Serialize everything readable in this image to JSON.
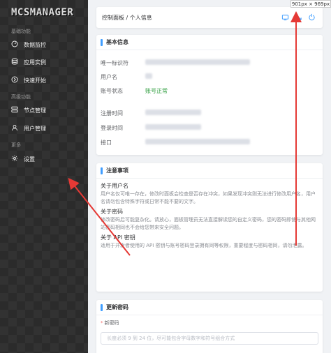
{
  "app": {
    "logo": "MCSMANAGER"
  },
  "sidebar": {
    "groups": [
      {
        "title": "基础功能"
      },
      {
        "title": "高级功能"
      },
      {
        "title": "更多"
      }
    ],
    "items": [
      {
        "label": "数据监控",
        "icon": "dashboard-icon"
      },
      {
        "label": "应用实例",
        "icon": "database-icon"
      },
      {
        "label": "快速开始",
        "icon": "rocket-icon"
      },
      {
        "label": "节点管理",
        "icon": "nodes-icon"
      },
      {
        "label": "用户管理",
        "icon": "user-icon"
      },
      {
        "label": "设置",
        "icon": "gear-icon"
      }
    ]
  },
  "header": {
    "breadcrumb": "控制面板 / 个人信息",
    "icons": [
      "refresh-icon",
      "expand-icon",
      "logout-icon"
    ]
  },
  "basic_info": {
    "title": "基本信息",
    "fields": [
      {
        "label": "唯一标识符",
        "value": ""
      },
      {
        "label": "用户名",
        "value": ""
      },
      {
        "label": "账号状态",
        "value": "账号正常"
      },
      {
        "label": "注册时间",
        "value": ""
      },
      {
        "label": "登录时间",
        "value": ""
      },
      {
        "label": "接口",
        "value": ""
      }
    ]
  },
  "notes": {
    "title": "注意事项",
    "sections": [
      {
        "heading": "关于用户名",
        "text": "用户名仅可唯一存在，修改时面板会检查是否存在冲突，如果发现冲突则无法进行修改用户名，用户名请勿包含特殊字符或日常不能不要的文字。"
      },
      {
        "heading": "关于密码",
        "text": "修改密码后可能复杂化。请放心，面板管理员无法直接解读您的自定义密码，您的密码即使与其他网站密码相同也不会给您带来安全问题。"
      },
      {
        "heading": "关于 API 密钥",
        "text": "适用于开发者使用的 API 密钥与账号密码登录拥有同等权限，重要程度与密码相同，请勿泄露。"
      }
    ]
  },
  "password": {
    "title": "更新密码",
    "field_label": "新密码",
    "placeholder": "长度必须 9 到 24 位，尽可能包含字母数字和符号组合方式"
  },
  "tooltip": {
    "text": "901px × 969px"
  },
  "colors": {
    "accent": "#409eff",
    "annotation": "#e53935",
    "status_ok": "#2c9c3c"
  }
}
